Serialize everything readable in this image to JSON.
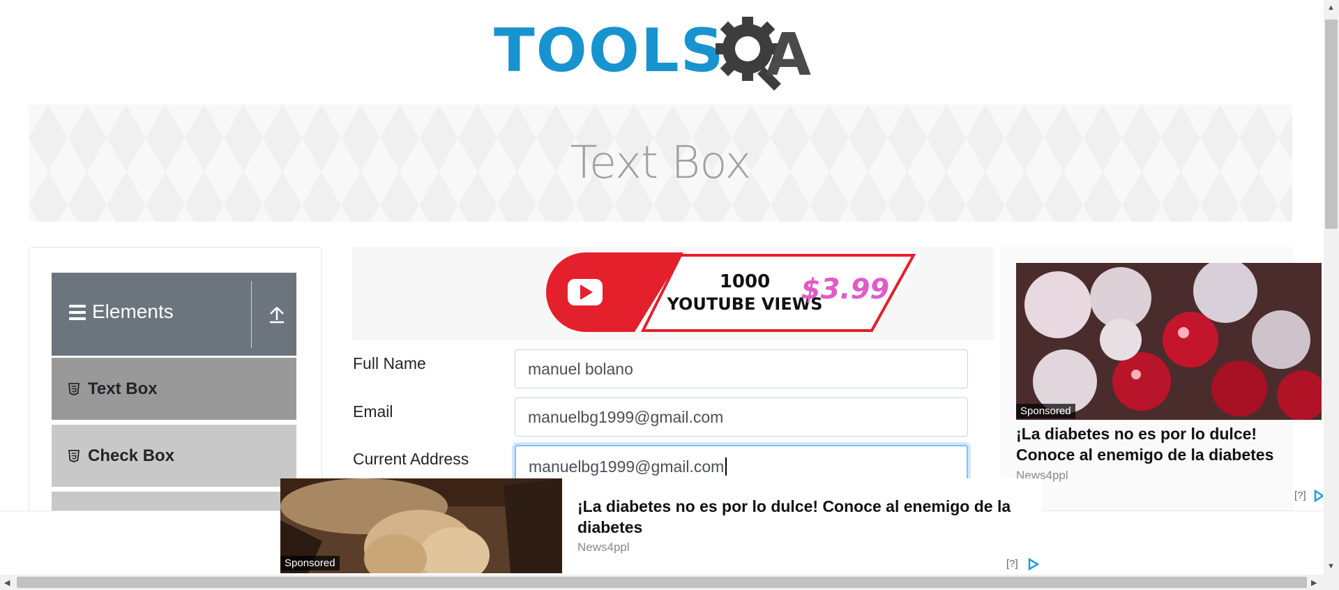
{
  "header": {
    "logo_text": "TOOLS",
    "logo_suffix": "A"
  },
  "banner": {
    "title": "Text Box"
  },
  "sidebar": {
    "group_title": "Elements",
    "items": [
      {
        "label": "Text Box",
        "icon": "html5-icon"
      },
      {
        "label": "Check Box",
        "icon": "html5-icon"
      }
    ]
  },
  "ad_top": {
    "line1": "1000",
    "line2": "YOUTUBE VIEWS",
    "price": "$3.99"
  },
  "form": {
    "full_name_label": "Full Name",
    "full_name_value": "manuel bolano",
    "email_label": "Email",
    "email_value": "manuelbg1999@gmail.com",
    "address_label": "Current Address",
    "address_value": "manuelbg1999@gmail.com"
  },
  "ad_right": {
    "sponsored": "Sponsored",
    "title": "¡La diabetes no es por lo dulce! Conoce al enemigo de la diabetes",
    "source": "News4ppl",
    "help": "[?]"
  },
  "ad_bottom": {
    "sponsored": "Sponsored",
    "title": "¡La diabetes no es por lo dulce! Conoce al enemigo de la diabetes",
    "source": "News4ppl",
    "help": "[?]"
  },
  "colors": {
    "brand_blue": "#1793cf",
    "sidebar_header": "#6c757d",
    "active_item": "#999999"
  }
}
